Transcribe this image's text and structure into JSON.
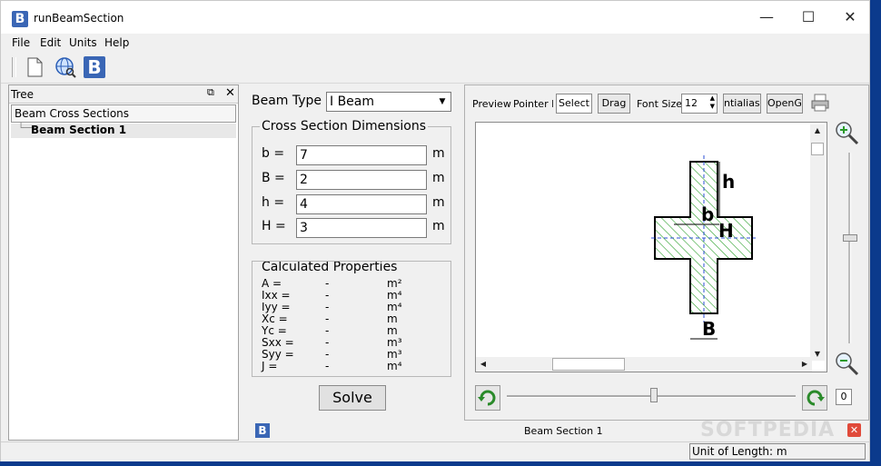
{
  "window": {
    "title": "runBeamSection",
    "icon_letter": "B"
  },
  "menu": [
    "File",
    "Edit",
    "Units",
    "Help"
  ],
  "tree": {
    "header": "Tree",
    "root": "Beam Cross Sections",
    "child": "Beam Section 1"
  },
  "form": {
    "beam_type_label": "Beam Type",
    "beam_type_value": "I Beam",
    "dims_title": "Cross Section Dimensions",
    "dims": [
      {
        "label": "b =",
        "value": "7",
        "unit": "m"
      },
      {
        "label": "B =",
        "value": "2",
        "unit": "m"
      },
      {
        "label": "h =",
        "value": "4",
        "unit": "m"
      },
      {
        "label": "H =",
        "value": "3",
        "unit": "m"
      }
    ],
    "props_title": "Calculated Properties",
    "props": [
      {
        "label": "A =",
        "value": "-",
        "unit": "m²"
      },
      {
        "label": "Ixx =",
        "value": "-",
        "unit": "m⁴"
      },
      {
        "label": "Iyy =",
        "value": "-",
        "unit": "m⁴"
      },
      {
        "label": "Xc =",
        "value": "-",
        "unit": "m"
      },
      {
        "label": "Yc =",
        "value": "-",
        "unit": "m"
      },
      {
        "label": "Sxx =",
        "value": "-",
        "unit": "m³"
      },
      {
        "label": "Syy =",
        "value": "-",
        "unit": "m³"
      },
      {
        "label": "J =",
        "value": "-",
        "unit": "m⁴"
      }
    ],
    "solve_label": "Solve"
  },
  "preview": {
    "preview_label": "Preview",
    "pointer_label": "Pointer M",
    "select_label": "Select",
    "drag_label": "Drag",
    "font_size_label": "Font Size",
    "font_size_value": "12",
    "antialias_label": "ntialiasin",
    "opengl_label": "OpenGL",
    "dim_labels": {
      "h": "h",
      "b": "b",
      "H": "H",
      "B": "B"
    },
    "slider_value": "0"
  },
  "status": {
    "section_name": "Beam Section 1",
    "unit_of_length": "Unit of Length: m"
  },
  "watermark": "SOFTPEDIA",
  "colors": {
    "hatch": "#2aa02a",
    "dash": "#2b4fd6",
    "accent": "#3a66b5"
  }
}
